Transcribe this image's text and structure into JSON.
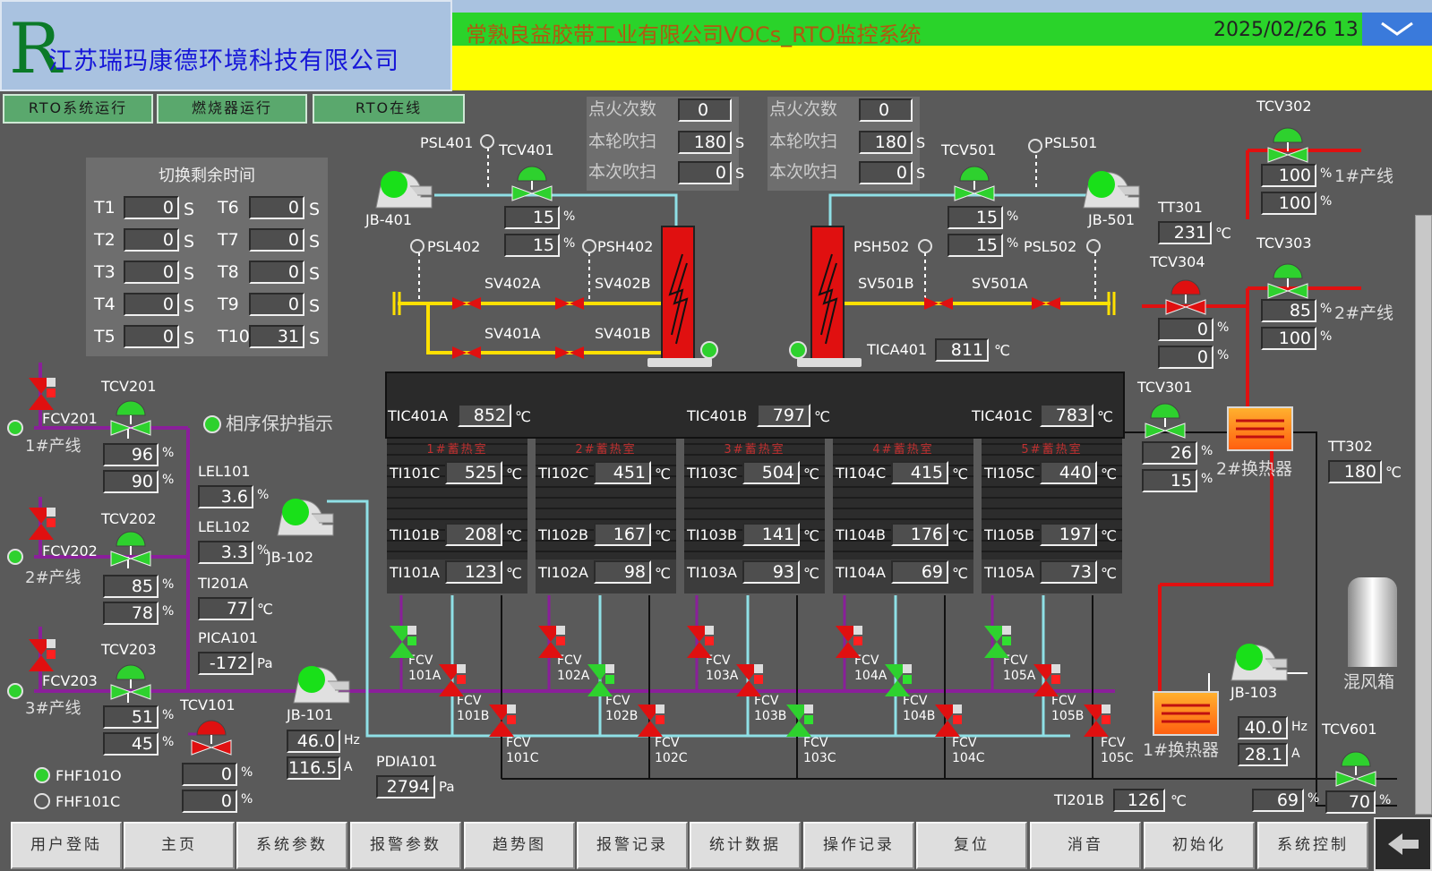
{
  "header": {
    "company": "江苏瑞玛康德环境科技有限公司",
    "system_title": "常熟良益胶带工业有限公司VOCs_RTO监控系统",
    "datetime": "2025/02/26 13"
  },
  "status_flags": [
    "RTO系统运行",
    "燃烧器运行",
    "RTO在线"
  ],
  "switch_panel": {
    "title": "切换剩余时间",
    "unit": "S",
    "timers": [
      {
        "label": "T1",
        "value": "0"
      },
      {
        "label": "T2",
        "value": "0"
      },
      {
        "label": "T3",
        "value": "0"
      },
      {
        "label": "T4",
        "value": "0"
      },
      {
        "label": "T5",
        "value": "0"
      },
      {
        "label": "T6",
        "value": "0"
      },
      {
        "label": "T7",
        "value": "0"
      },
      {
        "label": "T8",
        "value": "0"
      },
      {
        "label": "T9",
        "value": "0"
      },
      {
        "label": "T10",
        "value": "31"
      }
    ]
  },
  "ignition_left": {
    "ignite_label": "点火次数",
    "ignite": "0",
    "purge_round_label": "本轮吹扫",
    "purge_round": "180",
    "purge_now_label": "本次吹扫",
    "purge_now": "0",
    "unit": "S"
  },
  "ignition_right": {
    "ignite_label": "点火次数",
    "ignite": "0",
    "purge_round_label": "本轮吹扫",
    "purge_round": "180",
    "purge_now_label": "本次吹扫",
    "purge_now": "0",
    "unit": "S"
  },
  "units": {
    "pct": "%",
    "temp": "℃",
    "pa": "Pa",
    "hz": "Hz",
    "amp": "A"
  },
  "tags": {
    "psl401": "PSL401",
    "tcv401": "TCV401",
    "jb401": "JB-401",
    "psl402": "PSL402",
    "psh402": "PSH402",
    "sv402a": "SV402A",
    "sv402b": "SV402B",
    "sv401a": "SV401A",
    "sv401b": "SV401B",
    "tcv501": "TCV501",
    "psl501": "PSL501",
    "jb501": "JB-501",
    "psh502": "PSH502",
    "psl502": "PSL502",
    "sv501b": "SV501B",
    "sv501a": "SV501A",
    "tica401": "TICA401",
    "tcv302": "TCV302",
    "line1": "1#产线",
    "tt301": "TT301",
    "tcv303": "TCV303",
    "tcv304": "TCV304",
    "line2": "2#产线",
    "tcv301": "TCV301",
    "hx2": "2#换热器",
    "tt302": "TT302",
    "fcv201": "FCV201",
    "tcv201": "TCV201",
    "phase": "相序保护指示",
    "fcv202": "FCV202",
    "tcv202": "TCV202",
    "fcv203": "FCV203",
    "tcv203": "TCV203",
    "line3": "3#产线",
    "lel101": "LEL101",
    "lel102": "LEL102",
    "ti201a": "TI201A",
    "pica101": "PICA101",
    "jb102": "JB-102",
    "jb101": "JB-101",
    "tcv101": "TCV101",
    "pdia101": "PDIA101",
    "fhf101o": "FHF101O",
    "fhf101c": "FHF101C",
    "jb103": "JB-103",
    "hx1": "1#换热器",
    "mixbox": "混风箱",
    "tcv601": "TCV601",
    "ti201b": "TI201B"
  },
  "values": {
    "tcv401_a": "15",
    "tcv401_b": "15",
    "tcv501_a": "15",
    "tcv501_b": "15",
    "tica401": "811",
    "tcv302_a": "100",
    "tcv302_b": "100",
    "tt301": "231",
    "tcv303_a": "85",
    "tcv303_b": "100",
    "tcv304_a": "0",
    "tcv304_b": "0",
    "tcv301_a": "26",
    "tcv301_b": "15",
    "tt302": "180",
    "tcv201_a": "96",
    "tcv201_b": "90",
    "tcv202_a": "85",
    "tcv202_b": "78",
    "tcv203_a": "51",
    "tcv203_b": "45",
    "lel101": "3.6",
    "lel102": "3.3",
    "ti201a": "77",
    "pica101": "-172",
    "jb101_hz": "46.0",
    "jb101_a": "116.5",
    "tcv101_a": "0",
    "tcv101_b": "0",
    "pdia101": "2794",
    "jb103_hz": "40.0",
    "jb103_a": "28.1",
    "ti201b": "126",
    "tcv601_a": "69",
    "tcv601_b": "70"
  },
  "chamber": {
    "tic401a_label": "TIC401A",
    "tic401a": "852",
    "tic401b_label": "TIC401B",
    "tic401b": "797",
    "tic401c_label": "TIC401C",
    "tic401c": "783"
  },
  "regenerators": [
    {
      "title": "1#蓄热室",
      "c_label": "TI101C",
      "c": "525",
      "b_label": "TI101B",
      "b": "208",
      "a_label": "TI101A",
      "a": "123",
      "fa": "FCV\n101A",
      "fb": "FCV\n101B",
      "fc": "FCV\n101C"
    },
    {
      "title": "2#蓄热室",
      "c_label": "TI102C",
      "c": "451",
      "b_label": "TI102B",
      "b": "167",
      "a_label": "TI102A",
      "a": "98",
      "fa": "FCV\n102A",
      "fb": "FCV\n102B",
      "fc": "FCV\n102C"
    },
    {
      "title": "3#蓄热室",
      "c_label": "TI103C",
      "c": "504",
      "b_label": "TI103B",
      "b": "141",
      "a_label": "TI103A",
      "a": "93",
      "fa": "FCV\n103A",
      "fb": "FCV\n103B",
      "fc": "FCV\n103C"
    },
    {
      "title": "4#蓄热室",
      "c_label": "TI104C",
      "c": "415",
      "b_label": "TI104B",
      "b": "176",
      "a_label": "TI104A",
      "a": "69",
      "fa": "FCV\n104A",
      "fb": "FCV\n104B",
      "fc": "FCV\n104C"
    },
    {
      "title": "5#蓄热室",
      "c_label": "TI105C",
      "c": "440",
      "b_label": "TI105B",
      "b": "197",
      "a_label": "TI105A",
      "a": "73",
      "fa": "FCV\n105A",
      "fb": "FCV\n105B",
      "fc": "FCV\n105C"
    }
  ],
  "nav": [
    "用户登陆",
    "主页",
    "系统参数",
    "报警参数",
    "趋势图",
    "报警记录",
    "统计数据",
    "操作记录",
    "复位",
    "消音",
    "初始化",
    "系统控制"
  ],
  "colors": {
    "header_green": "#2ad32a",
    "header_yellow": "#ffff00",
    "bg": "#5a5a5a",
    "pipe_cyan": "#8fe0e6",
    "pipe_yellow": "#ffe000",
    "pipe_purple": "#8a1f9a",
    "pipe_red": "#e01010",
    "run_green": "#2ed12e"
  }
}
